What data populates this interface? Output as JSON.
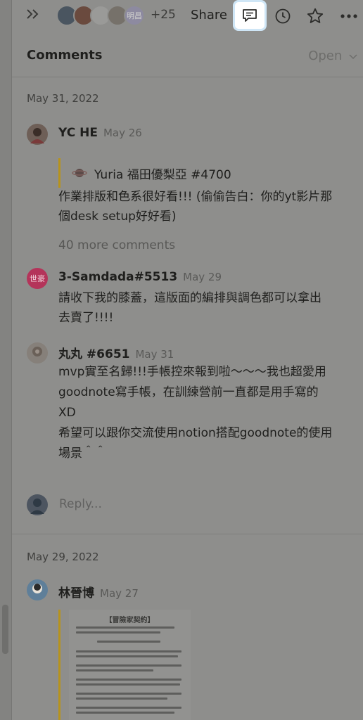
{
  "toolbar": {
    "expand_icon": "double-chevron-right",
    "avatar_more_count": "+25",
    "avatar_badge": "明昌",
    "share_label": "Share",
    "comment_icon": "comment-bubble",
    "history_icon": "clock",
    "favorite_icon": "star",
    "more_icon": "ellipsis"
  },
  "panel": {
    "title": "Comments",
    "filter_label": "Open",
    "threads": [
      {
        "date": "May 31, 2022",
        "comments": [
          {
            "author": "YC HE",
            "time": "May 26",
            "quote": "Yuria 福田優梨亞 #4700",
            "text_line1": "作業排版和色系很好看!!! (偷偷告白：你的yt影片那",
            "text_line2": "個desk setup好好看)"
          },
          {
            "more_comments": "40 more comments"
          },
          {
            "author": "3-Samdada#5513",
            "avatar_text": "世豪",
            "time": "May 29",
            "text_line1": "請收下我的膝蓋，這版面的編排與調色都可以拿出",
            "text_line2": "去賣了!!!!"
          },
          {
            "author": "丸丸 #6651",
            "time": "May 31",
            "text_line1": "mvp實至名歸!!!手帳控來報到啦～～～我也超愛用",
            "text_line2": "goodnote寫手帳，在訓練營前一直都是用手寫的",
            "text_line3": "XD",
            "text_line4": "希望可以跟你交流使用notion搭配goodnote的使用",
            "text_line5": "場景＾＾"
          }
        ],
        "reply_placeholder": "Reply..."
      },
      {
        "date": "May 29, 2022",
        "comments": [
          {
            "author": "林晉博",
            "time": "May 27",
            "image_title": "【冒險家契約】"
          }
        ]
      }
    ]
  }
}
